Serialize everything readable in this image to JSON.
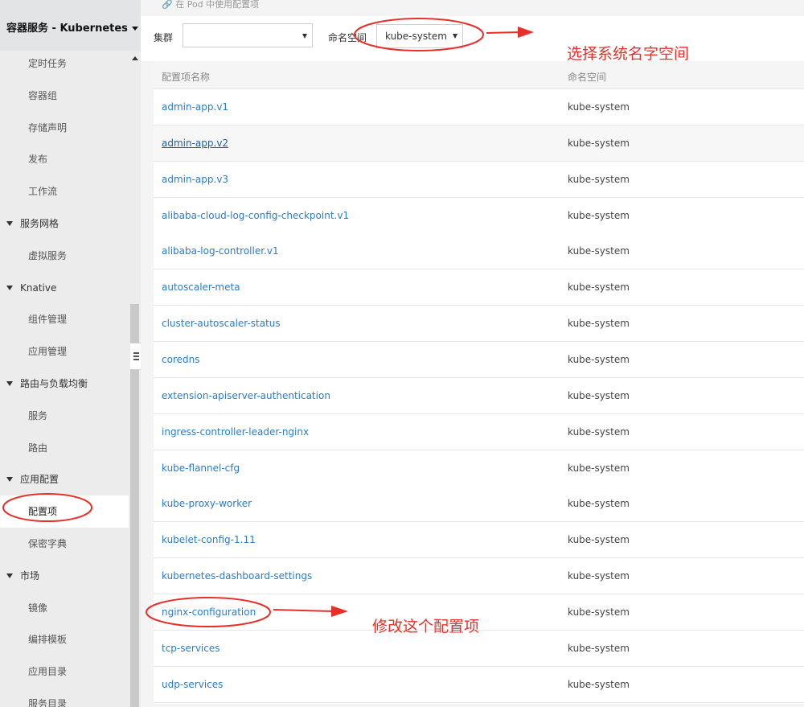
{
  "sidebar": {
    "title": "容器服务 - Kubernetes",
    "items": [
      {
        "label": "定时任务",
        "kind": "sub"
      },
      {
        "label": "容器组",
        "kind": "sub"
      },
      {
        "label": "存储声明",
        "kind": "sub"
      },
      {
        "label": "发布",
        "kind": "sub"
      },
      {
        "label": "工作流",
        "kind": "sub"
      },
      {
        "label": "服务网格",
        "kind": "group"
      },
      {
        "label": "虚拟服务",
        "kind": "sub"
      },
      {
        "label": "Knative",
        "kind": "group"
      },
      {
        "label": "组件管理",
        "kind": "sub"
      },
      {
        "label": "应用管理",
        "kind": "sub"
      },
      {
        "label": "路由与负载均衡",
        "kind": "group"
      },
      {
        "label": "服务",
        "kind": "sub"
      },
      {
        "label": "路由",
        "kind": "sub"
      },
      {
        "label": "应用配置",
        "kind": "group"
      },
      {
        "label": "配置项",
        "kind": "sub",
        "active": true
      },
      {
        "label": "保密字典",
        "kind": "sub"
      },
      {
        "label": "市场",
        "kind": "group"
      },
      {
        "label": "镜像",
        "kind": "sub"
      },
      {
        "label": "编排模板",
        "kind": "sub"
      },
      {
        "label": "应用目录",
        "kind": "sub"
      },
      {
        "label": "服务目录",
        "kind": "sub"
      }
    ]
  },
  "main": {
    "pod_tip": "在 Pod 中使用配置项",
    "filters": {
      "cluster_label": "集群",
      "cluster_value": "",
      "namespace_label": "命名空间",
      "namespace_value": "kube-system"
    },
    "table": {
      "columns": [
        "配置项名称",
        "命名空间"
      ],
      "rows": [
        {
          "name": "admin-app.v1",
          "namespace": "kube-system"
        },
        {
          "name": "admin-app.v2",
          "namespace": "kube-system"
        },
        {
          "name": "admin-app.v3",
          "namespace": "kube-system"
        },
        {
          "name": "alibaba-cloud-log-config-checkpoint.v1",
          "namespace": "kube-system"
        },
        {
          "name": "alibaba-log-controller.v1",
          "namespace": "kube-system"
        },
        {
          "name": "autoscaler-meta",
          "namespace": "kube-system"
        },
        {
          "name": "cluster-autoscaler-status",
          "namespace": "kube-system"
        },
        {
          "name": "coredns",
          "namespace": "kube-system"
        },
        {
          "name": "extension-apiserver-authentication",
          "namespace": "kube-system"
        },
        {
          "name": "ingress-controller-leader-nginx",
          "namespace": "kube-system"
        },
        {
          "name": "kube-flannel-cfg",
          "namespace": "kube-system"
        },
        {
          "name": "kube-proxy-worker",
          "namespace": "kube-system"
        },
        {
          "name": "kubelet-config-1.11",
          "namespace": "kube-system"
        },
        {
          "name": "kubernetes-dashboard-settings",
          "namespace": "kube-system"
        },
        {
          "name": "nginx-configuration",
          "namespace": "kube-system"
        },
        {
          "name": "tcp-services",
          "namespace": "kube-system"
        },
        {
          "name": "udp-services",
          "namespace": "kube-system"
        }
      ]
    }
  },
  "annotations": {
    "select_namespace": "选择系统名字空间",
    "modify_item": "修改这个配置项",
    "color": "#e8302a"
  },
  "colors": {
    "link": "#2a7cc7",
    "sidebar_bg": "#ececec",
    "page_bg": "#f4f4f4"
  }
}
